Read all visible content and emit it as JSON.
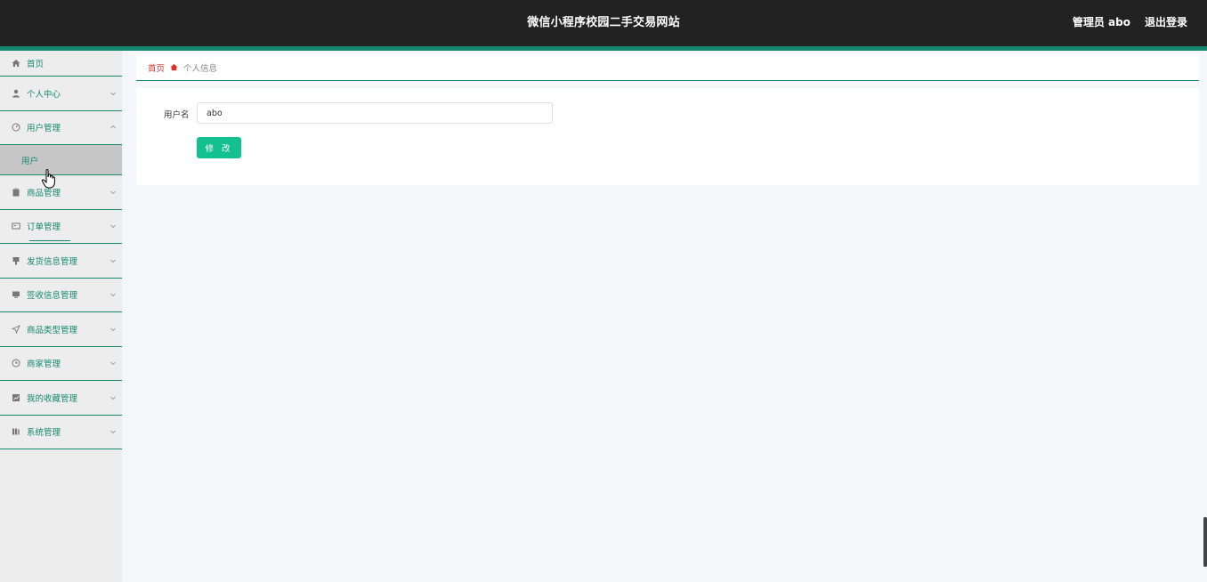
{
  "header": {
    "title": "微信小程序校园二手交易网站",
    "user_label": "管理员 abo",
    "logout_label": "退出登录"
  },
  "sidebar": {
    "items": [
      {
        "label": "首页",
        "icon": "home-icon"
      },
      {
        "label": "个人中心",
        "icon": "user-icon"
      },
      {
        "label": "用户管理",
        "icon": "gauge-icon",
        "expanded": true,
        "children": [
          {
            "label": "用户"
          }
        ]
      },
      {
        "label": "商品管理",
        "icon": "clipboard-icon"
      },
      {
        "label": "订单管理",
        "icon": "ticket-icon"
      },
      {
        "label": "发货信息管理",
        "icon": "pin-icon"
      },
      {
        "label": "签收信息管理",
        "icon": "monitor-icon"
      },
      {
        "label": "商品类型管理",
        "icon": "send-icon"
      },
      {
        "label": "商家管理",
        "icon": "clock-icon"
      },
      {
        "label": "我的收藏管理",
        "icon": "chart-icon"
      },
      {
        "label": "系统管理",
        "icon": "book-icon"
      }
    ]
  },
  "breadcrumb": {
    "home": "首页",
    "current": "个人信息"
  },
  "form": {
    "username_label": "用户名",
    "username_value": "abo",
    "submit_label": "修 改"
  },
  "colors": {
    "topbar": "#222222",
    "accent": "#14876e",
    "button": "#13c08f",
    "breadcrumb_home": "#d9342b"
  }
}
